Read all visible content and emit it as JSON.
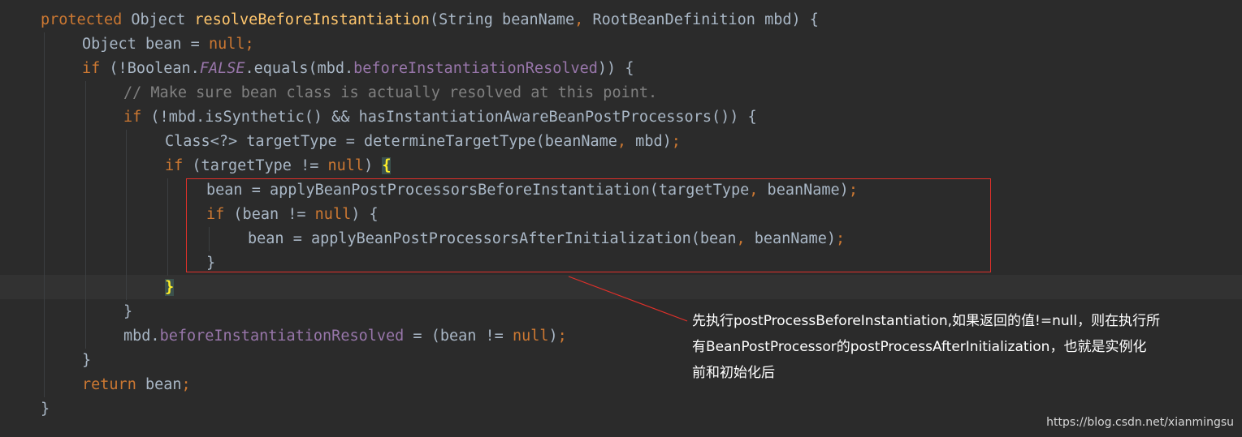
{
  "editor": {
    "theme": "darcula",
    "background": "#2b2b2b",
    "keyword_color": "#cc7832",
    "method_color": "#ffc66d",
    "field_color": "#9876aa",
    "comment_color": "#808080",
    "text_color": "#a9b7c6",
    "highlight_box_color": "#e0302a",
    "lines": {
      "l1": {
        "t1": "protected",
        "t2": " Object ",
        "t3": "resolveBeforeInstantiation",
        "t4": "(String beanName",
        "t5": ",",
        "t6": " RootBeanDefinition mbd) {"
      },
      "l2": {
        "t1": "Object bean = ",
        "t2": "null;"
      },
      "l3": {
        "t1": "if",
        "t2": " (!Boolean.",
        "t3": "FALSE",
        "t4": ".equals(mbd.",
        "t5": "beforeInstantiationResolved",
        "t6": ")) {"
      },
      "l4": {
        "t1": "// Make sure bean class is actually resolved at this point."
      },
      "l5": {
        "t1": "if",
        "t2": " (!mbd.isSynthetic() && hasInstantiationAwareBeanPostProcessors()) {"
      },
      "l6": {
        "t1": "Class<?> targetType = determineTargetType(beanName",
        "t2": ",",
        "t3": " mbd)",
        "t4": ";"
      },
      "l7": {
        "t1": "if",
        "t2": " (targetType != ",
        "t3": "null",
        "t4": ") ",
        "t5": "{"
      },
      "l8": {
        "t1": "bean = applyBeanPostProcessorsBeforeInstantiation(targetType",
        "t2": ",",
        "t3": " beanName)",
        "t4": ";"
      },
      "l9": {
        "t1": "if",
        "t2": " (bean != ",
        "t3": "null",
        "t4": ") {"
      },
      "l10": {
        "t1": "bean = applyBeanPostProcessorsAfterInitialization(bean",
        "t2": ",",
        "t3": " beanName)",
        "t4": ";"
      },
      "l11": {
        "t1": "}"
      },
      "l12": {
        "t1": "}"
      },
      "l13": {
        "t1": "}"
      },
      "l14": {
        "t1": "mbd.",
        "t2": "beforeInstantiationResolved",
        "t3": " = (bean != ",
        "t4": "null",
        "t5": ")",
        "t6": ";"
      },
      "l15": {
        "t1": "}"
      },
      "l16": {
        "t1": "return",
        "t2": " bean",
        "t3": ";"
      },
      "l17": {
        "t1": "}"
      }
    }
  },
  "annotation": {
    "line1": "先执行postProcessBeforeInstantiation,如果返回的值!=null，则在执行所",
    "line2": "有BeanPostProcessor的postProcessAfterInitialization，也就是实例化",
    "line3": "前和初始化后"
  },
  "watermark": "https://blog.csdn.net/xianmingsu"
}
